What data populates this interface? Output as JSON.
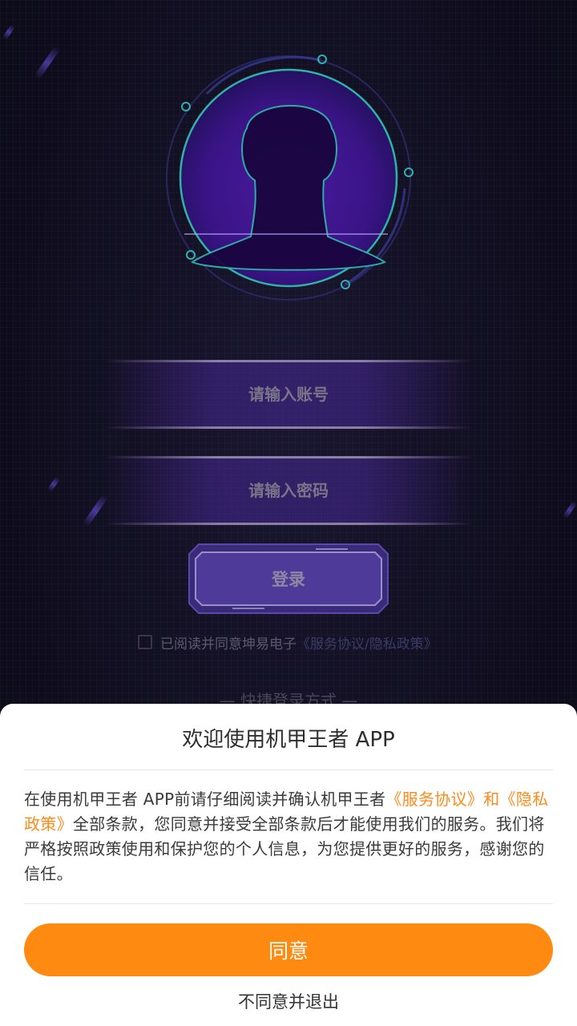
{
  "login": {
    "account_placeholder": "请输入账号",
    "password_placeholder": "请输入密码",
    "login_label": "登录",
    "agree_prefix": "已阅读并同意坤易电子",
    "agree_link": "《服务协议/隐私政策》",
    "quick_login": "— 快捷登录方式 —"
  },
  "modal": {
    "title": "欢迎使用机甲王者 APP",
    "body_part1": "在使用机甲王者 APP前请仔细阅读并确认机甲王者",
    "body_link": "《服务协议》和《隐私政策》",
    "body_part2": "全部条款，您同意并接受全部条款后才能使用我们的服务。我们将严格按照政策使用和保护您的个人信息，为您提供更好的服务，感谢您的信任。",
    "agree_label": "同意",
    "disagree_label": "不同意并退出"
  },
  "icons": {
    "avatar": "user-silhouette-icon",
    "checkbox": "checkbox-unchecked-icon"
  },
  "colors": {
    "accent_orange": "#ff8a12",
    "background_dark": "#0f0d1e",
    "purple_glow": "#6b3fd0",
    "teal_ring": "#2fb3a8"
  }
}
